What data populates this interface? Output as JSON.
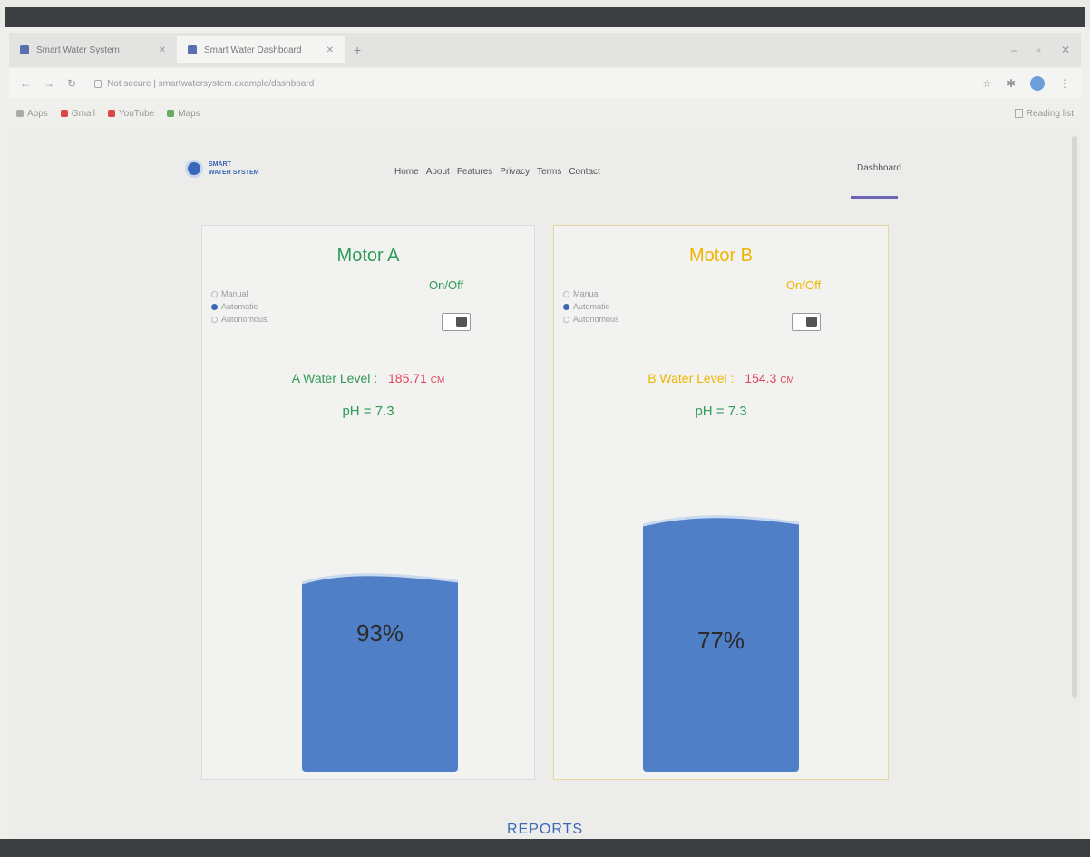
{
  "browser": {
    "tabs": [
      {
        "title": "Smart Water System"
      },
      {
        "title": "Smart Water Dashboard"
      }
    ],
    "address": "Not secure | smartwatersystem.example/dashboard",
    "bookmarks": [
      "Apps",
      "Gmail",
      "YouTube",
      "Maps"
    ],
    "reading_list": "Reading list"
  },
  "site": {
    "logo_line1": "SMART",
    "logo_line2": "WATER SYSTEM",
    "nav": [
      "Home",
      "About",
      "Features",
      "Privacy",
      "Terms",
      "Contact"
    ],
    "dashboard_label": "Dashboard"
  },
  "motors": [
    {
      "title": "Motor A",
      "onoff_label": "On/Off",
      "modes": [
        {
          "label": "Manual",
          "selected": false
        },
        {
          "label": "Automatic",
          "selected": true
        },
        {
          "label": "Autonomous",
          "selected": false
        }
      ],
      "water_level_label": "A Water Level :",
      "water_level_value": "185.71",
      "water_level_unit": "CM",
      "ph": "pH = 7.3",
      "tank_percent": "93%",
      "tank_fill": 0.93,
      "accent_color": "#2f9b57"
    },
    {
      "title": "Motor B",
      "onoff_label": "On/Off",
      "modes": [
        {
          "label": "Manual",
          "selected": false
        },
        {
          "label": "Automatic",
          "selected": true
        },
        {
          "label": "Autonomous",
          "selected": false
        }
      ],
      "water_level_label": "B Water Level :",
      "water_level_value": "154.3",
      "water_level_unit": "CM",
      "ph": "pH = 7.3",
      "tank_percent": "77%",
      "tank_fill": 0.77,
      "accent_color": "#f0b400"
    }
  ],
  "reports_label": "REPORTS",
  "colors": {
    "water": "#4f7fc6",
    "level_value": "#e0445c",
    "brand": "#3a68b8",
    "dashboard_underline": "#6c64b6"
  }
}
